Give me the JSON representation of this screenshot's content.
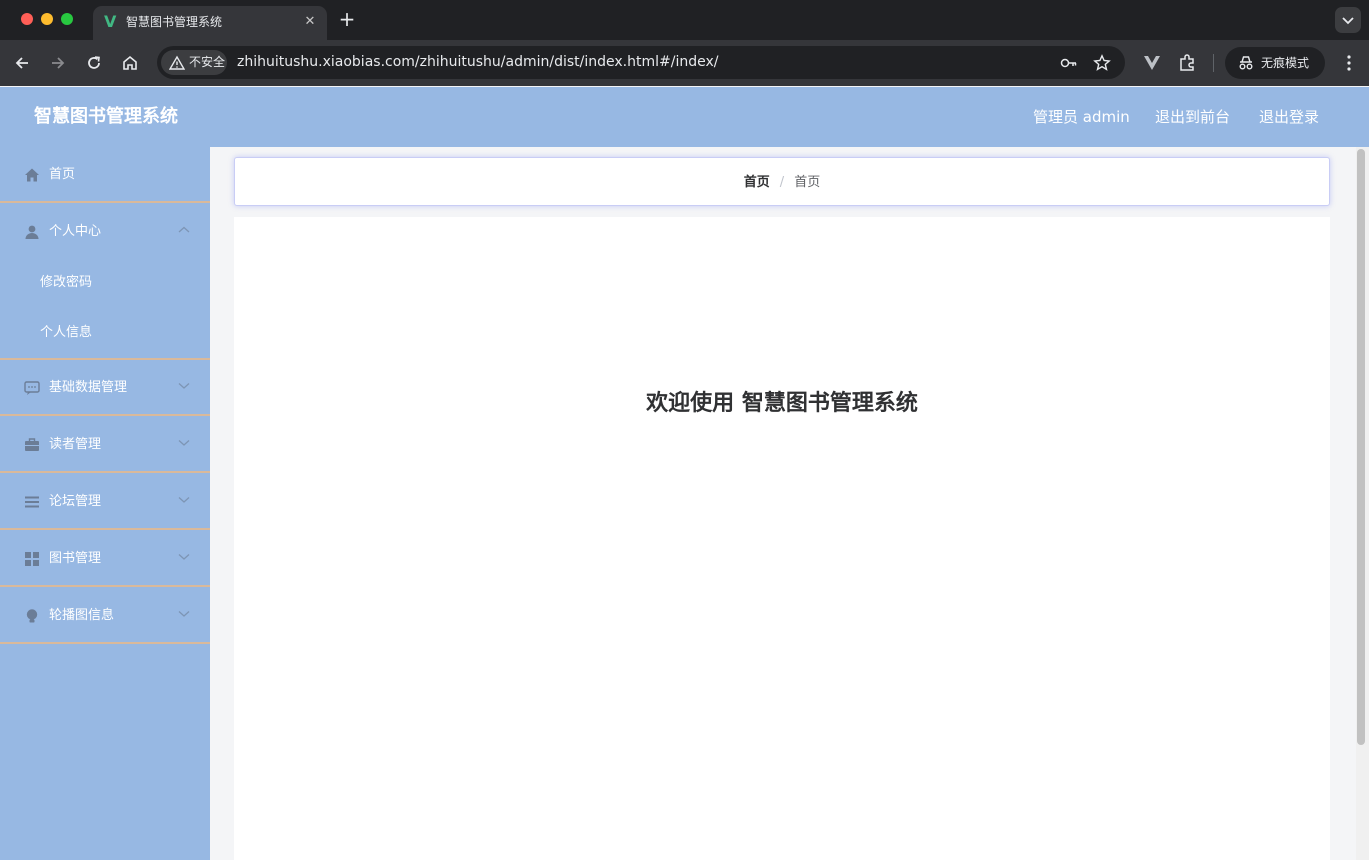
{
  "browser": {
    "tab": {
      "title": "智慧图书管理系统",
      "favicon": "vue-logo-icon"
    },
    "security_label": "不安全",
    "url": "zhihuitushu.xiaobias.com/zhihuitushu/admin/dist/index.html#/index/",
    "incognito_label": "无痕模式"
  },
  "header": {
    "title": "智慧图书管理系统",
    "links": {
      "admin": "管理员 admin",
      "frontend": "退出到前台",
      "logout": "退出登录"
    }
  },
  "sidebar": {
    "items": [
      {
        "label": "首页",
        "icon": "home-icon"
      },
      {
        "label": "个人中心",
        "icon": "user-icon",
        "expanded": true,
        "children": [
          {
            "label": "修改密码"
          },
          {
            "label": "个人信息"
          }
        ]
      },
      {
        "label": "基础数据管理",
        "icon": "chat-icon"
      },
      {
        "label": "读者管理",
        "icon": "briefcase-icon"
      },
      {
        "label": "论坛管理",
        "icon": "list-icon"
      },
      {
        "label": "图书管理",
        "icon": "grid-icon"
      },
      {
        "label": "轮播图信息",
        "icon": "bulb-icon"
      }
    ]
  },
  "breadcrumb": {
    "home": "首页",
    "current": "首页",
    "separator": "/"
  },
  "main": {
    "welcome": "欢迎使用 智慧图书管理系统"
  },
  "colors": {
    "header_bg": "#97b8e3",
    "sidebar_bg": "#97b8e3",
    "divider": "#d9b99b"
  }
}
